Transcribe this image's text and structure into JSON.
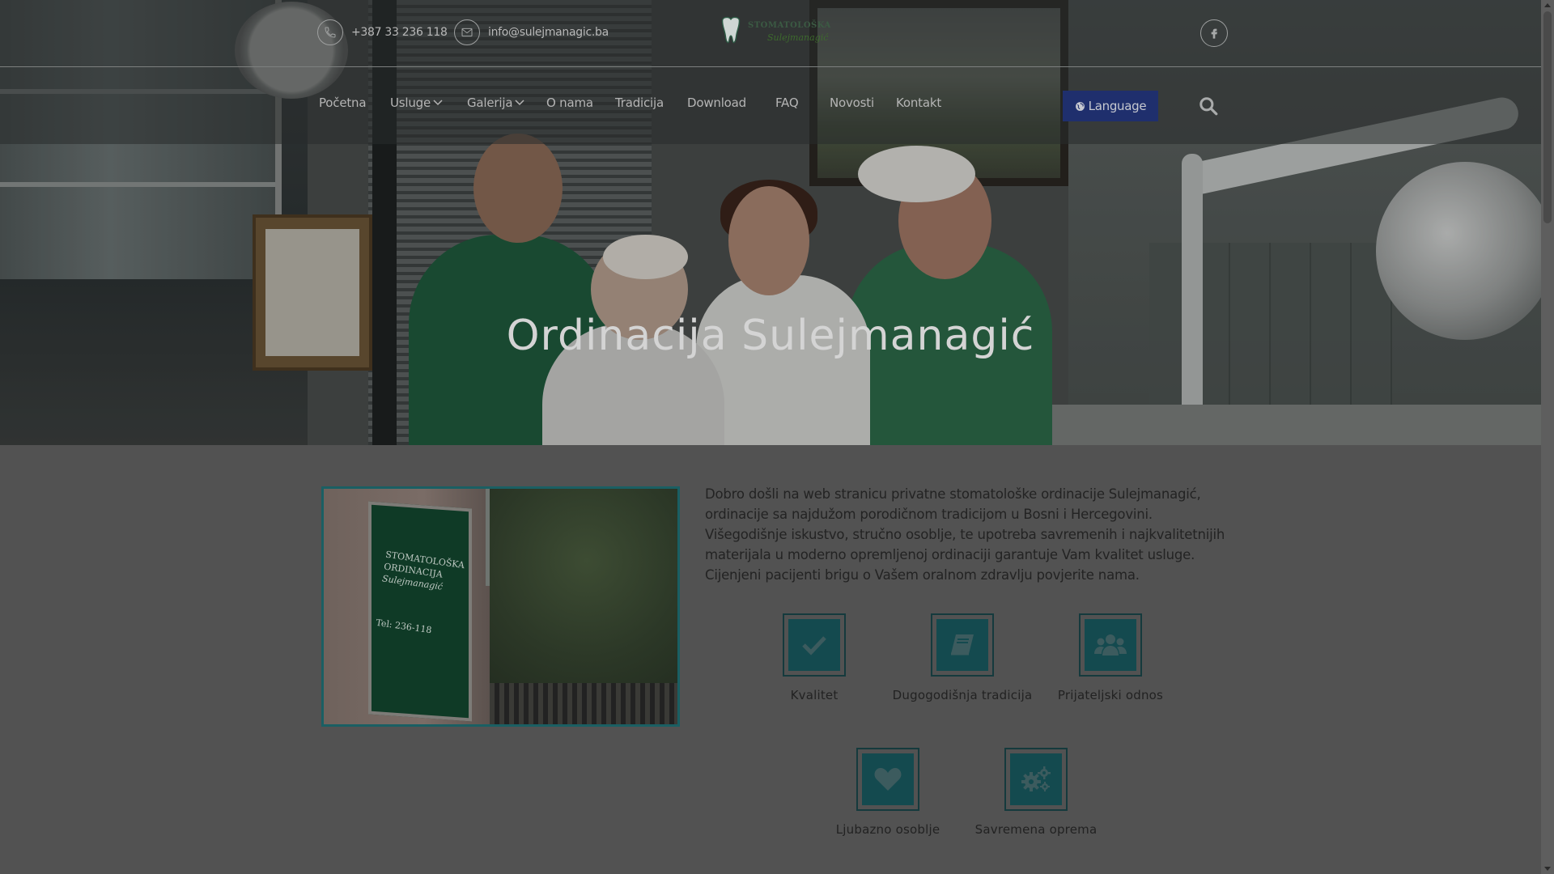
{
  "header": {
    "phone": "+387 33 236 118",
    "email": "info@sulejmanagic.ba",
    "logo_line1": "STOMATOLOŠKA",
    "logo_line2": "Sulejmanagić",
    "facebook_icon": "facebook-icon"
  },
  "nav": {
    "items": [
      {
        "label": "Početna",
        "dropdown": false
      },
      {
        "label": "Usluge",
        "dropdown": true
      },
      {
        "label": "Galerija",
        "dropdown": true
      },
      {
        "label": "O nama",
        "dropdown": false
      },
      {
        "label": "Tradicija",
        "dropdown": false
      },
      {
        "label": "Download",
        "dropdown": false
      },
      {
        "label": "FAQ",
        "dropdown": false
      },
      {
        "label": "Novosti",
        "dropdown": false
      },
      {
        "label": "Kontakt",
        "dropdown": false
      }
    ],
    "language_label": "Language",
    "search_icon": "search-icon"
  },
  "hero": {
    "title": "Ordinacija Sulejmanagić"
  },
  "photo": {
    "sign_lines": [
      "STOMATOLOŠKA",
      "ORDINACIJA",
      "Sulejmanagić",
      "Tel: 236-118"
    ]
  },
  "intro": {
    "text": "Dobro došli na web stranicu privatne stomatološke ordinacije Sulejmanagić, ordinacije sa najdužom porodičnom tradicijom u Bosni i Hercegovini. Višegodišnje iskustvo, stručno osoblje, te upotreba savremenih i najkvalitetnijih materijala u moderno opremljenoj ordinaciji garantuje Vam kvalitet usluge. Cijenjeni pacijenti brigu o Vašem oralnom zdravlju povjerite nama."
  },
  "features": [
    {
      "label": "Kvalitet",
      "icon": "check-icon"
    },
    {
      "label": "Dugogodišnja tradicija",
      "icon": "book-icon"
    },
    {
      "label": "Prijateljski odnos",
      "icon": "users-icon"
    },
    {
      "label": "Ljubazno osoblje",
      "icon": "heart-icon"
    },
    {
      "label": "Savremena oprema",
      "icon": "gears-icon"
    }
  ],
  "colors": {
    "accent": "#144a4f",
    "language_button": "#1f2f6d"
  }
}
